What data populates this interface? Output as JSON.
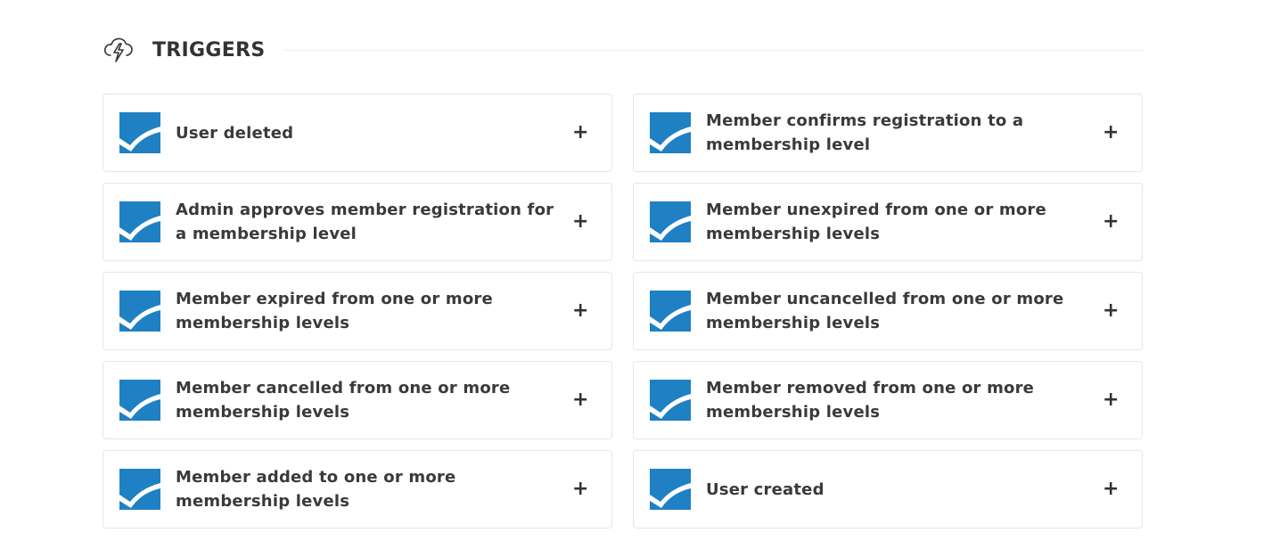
{
  "header": {
    "title": "TRIGGERS",
    "icon": "lightning-bolt-icon"
  },
  "colors": {
    "logo_blue": "#1f80c3",
    "text": "#3a3a3a",
    "border": "#e6e6e6"
  },
  "triggers": [
    {
      "label": "User deleted",
      "action": "+"
    },
    {
      "label": "Member confirms registration to a membership level",
      "action": "+"
    },
    {
      "label": "Admin approves member registration for a membership level",
      "action": "+"
    },
    {
      "label": "Member unexpired from one or more membership levels",
      "action": "+"
    },
    {
      "label": "Member expired from one or more membership levels",
      "action": "+"
    },
    {
      "label": "Member uncancelled from one or more membership levels",
      "action": "+"
    },
    {
      "label": "Member cancelled from one or more membership levels",
      "action": "+"
    },
    {
      "label": "Member removed from one or more membership levels",
      "action": "+"
    },
    {
      "label": "Member added to one or more membership levels",
      "action": "+"
    },
    {
      "label": "User created",
      "action": "+"
    }
  ]
}
